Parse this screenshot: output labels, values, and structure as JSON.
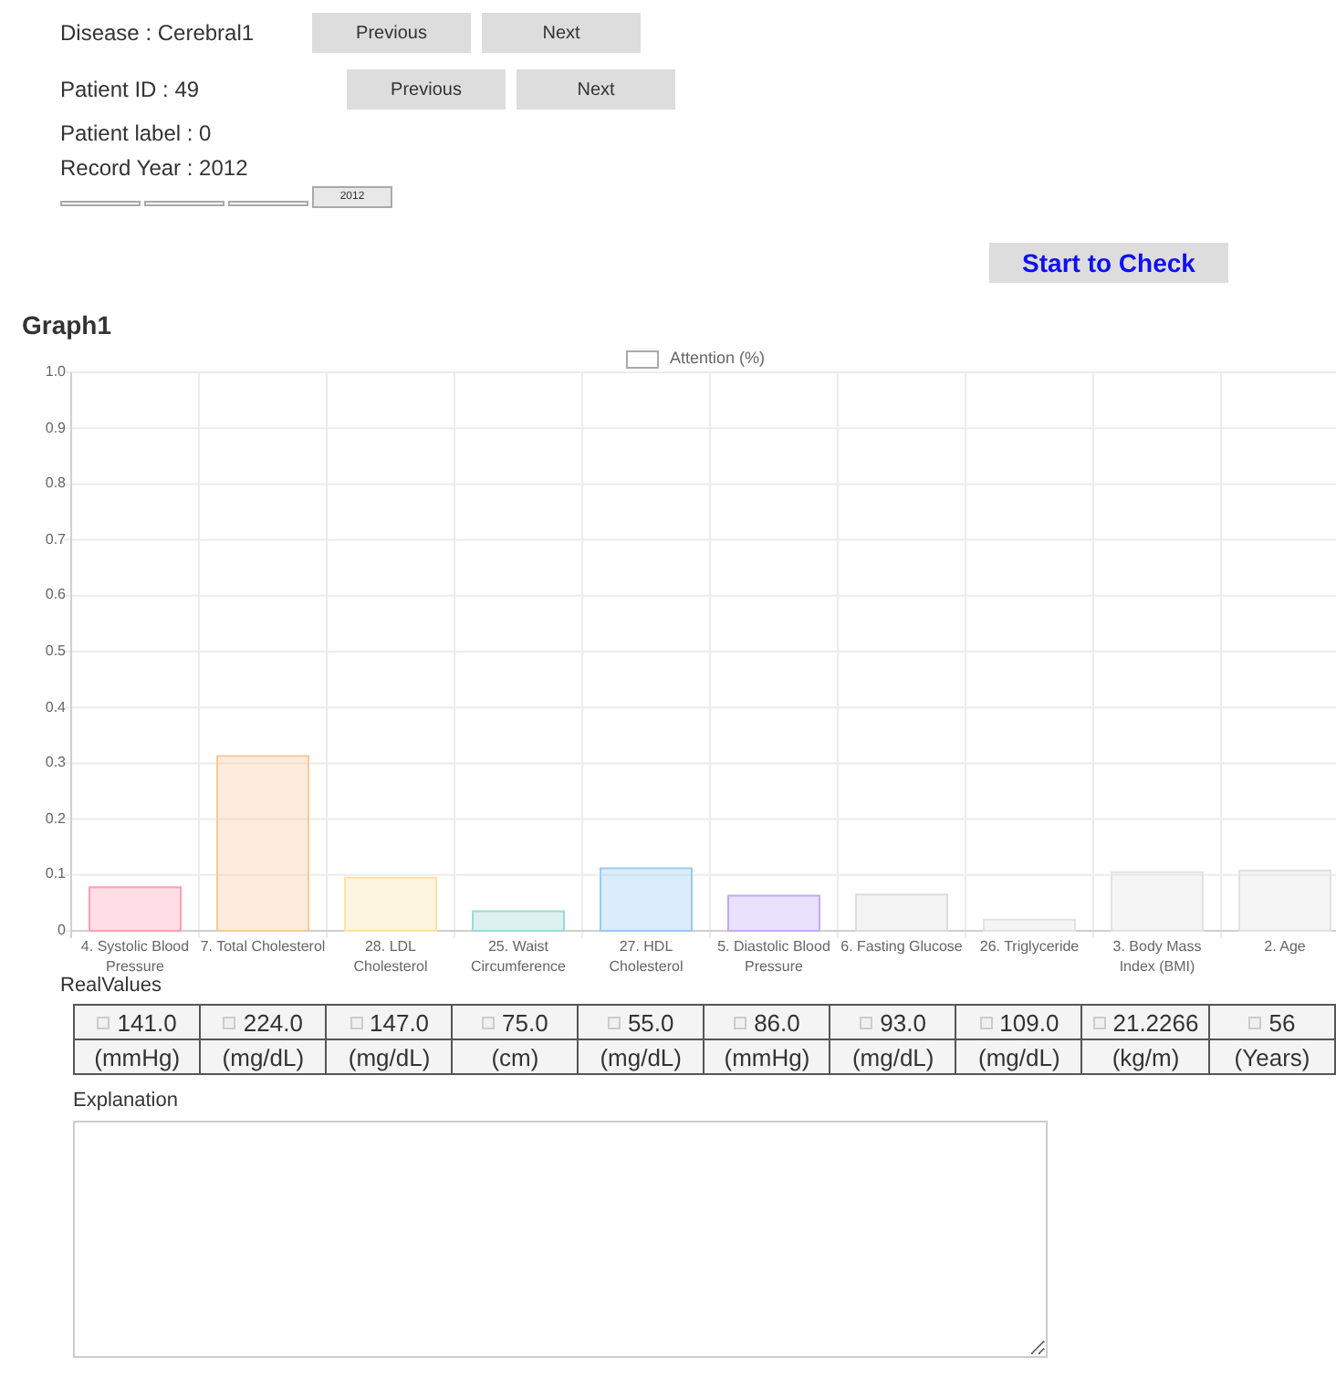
{
  "disease": {
    "label": "Disease : Cerebral1",
    "buttons": [
      "Previous",
      "Next"
    ]
  },
  "patient": {
    "label": "Patient ID : 49",
    "buttons": [
      "Previous",
      "Next"
    ]
  },
  "patient_label": "Patient label : 0",
  "record_year": "Record Year : 2012",
  "year_steps": [
    {
      "selected": false
    },
    {
      "selected": false
    },
    {
      "selected": false
    },
    {
      "selected": true,
      "label": "2012"
    }
  ],
  "check_button": "Start to Check",
  "graph_title": "Graph1",
  "chart": {
    "chart_data": {
      "type": "bar",
      "categories": [
        "4.  Systolic Blood Pressure",
        "7.  Total Cholesterol",
        "28. LDL Cholesterol",
        "25. Waist Circumference",
        "27. HDL Cholesterol",
        "5.  Diastolic Blood Pressure",
        "6.  Fasting Glucose",
        "26. Triglyceride",
        "3.  Body Mass Index (BMI)",
        "2.  Age"
      ],
      "series": [
        {
          "name": "Attention (%)",
          "values": [
            0.078,
            0.313,
            0.095,
            0.035,
            0.112,
            0.063,
            0.065,
            0.02,
            0.105,
            0.108
          ]
        }
      ],
      "ylim": [
        0,
        1
      ],
      "grid": true,
      "yticks": [
        0,
        0.1,
        0.2,
        0.3,
        0.4,
        0.5,
        0.6,
        0.7,
        0.8,
        0.9,
        {
          "value": 1,
          "label": "1.0"
        }
      ]
    }
  },
  "real_values_title": "RealValues",
  "real_values": [
    {
      "value": "141.0",
      "unit": "(mmHg)",
      "checked": false
    },
    {
      "value": "224.0",
      "unit": "(mg/dL)",
      "checked": false
    },
    {
      "value": "147.0",
      "unit": "(mg/dL)",
      "checked": false
    },
    {
      "value": "75.0",
      "unit": "(cm)",
      "checked": false
    },
    {
      "value": "55.0",
      "unit": "(mg/dL)",
      "checked": false
    },
    {
      "value": "86.0",
      "unit": "(mmHg)",
      "checked": false
    },
    {
      "value": "93.0",
      "unit": "(mg/dL)",
      "checked": false
    },
    {
      "value": "109.0",
      "unit": "(mg/dL)",
      "checked": false
    },
    {
      "value": "21.2266",
      "unit": "(kg/m)",
      "checked": false
    },
    {
      "value": "56",
      "unit": "(Years)",
      "checked": false
    }
  ],
  "explanation": {
    "label": "Explanation"
  }
}
